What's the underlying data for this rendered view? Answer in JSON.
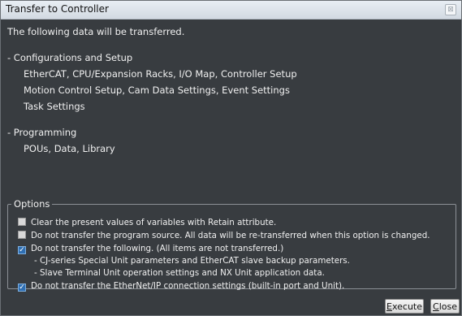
{
  "window": {
    "title": "Transfer to Controller",
    "close_glyph": "⊠"
  },
  "intro": "The following data will be transferred.",
  "sections": {
    "config_header": "- Configurations and Setup",
    "config_lines": [
      "EtherCAT, CPU/Expansion Racks, I/O Map, Controller Setup",
      "Motion Control Setup, Cam Data Settings, Event Settings",
      "Task Settings"
    ],
    "prog_header": "- Programming",
    "prog_lines": [
      "POUs, Data, Library"
    ]
  },
  "options": {
    "legend": "Options",
    "items": [
      {
        "label": "Clear the present values of variables with Retain attribute.",
        "checked": false
      },
      {
        "label": "Do not transfer the program source. All data will be re-transferred when this option is changed.",
        "checked": false
      },
      {
        "label": "Do not transfer the following. (All items are not transferred.)",
        "checked": true
      },
      {
        "label": "Do not transfer the EtherNet/IP connection settings (built-in port and Unit).",
        "checked": true
      }
    ],
    "sub_items": [
      "- CJ-series Special Unit parameters and EtherCAT slave backup parameters.",
      "- Slave Terminal Unit operation settings and NX Unit application data."
    ]
  },
  "buttons": {
    "execute_mnemonic": "E",
    "execute_rest": "xecute",
    "close_mnemonic": "C",
    "close_rest": "lose"
  },
  "colors": {
    "dialog_bg": "#383c40",
    "checkbox_checked": "#2f6fb3"
  }
}
